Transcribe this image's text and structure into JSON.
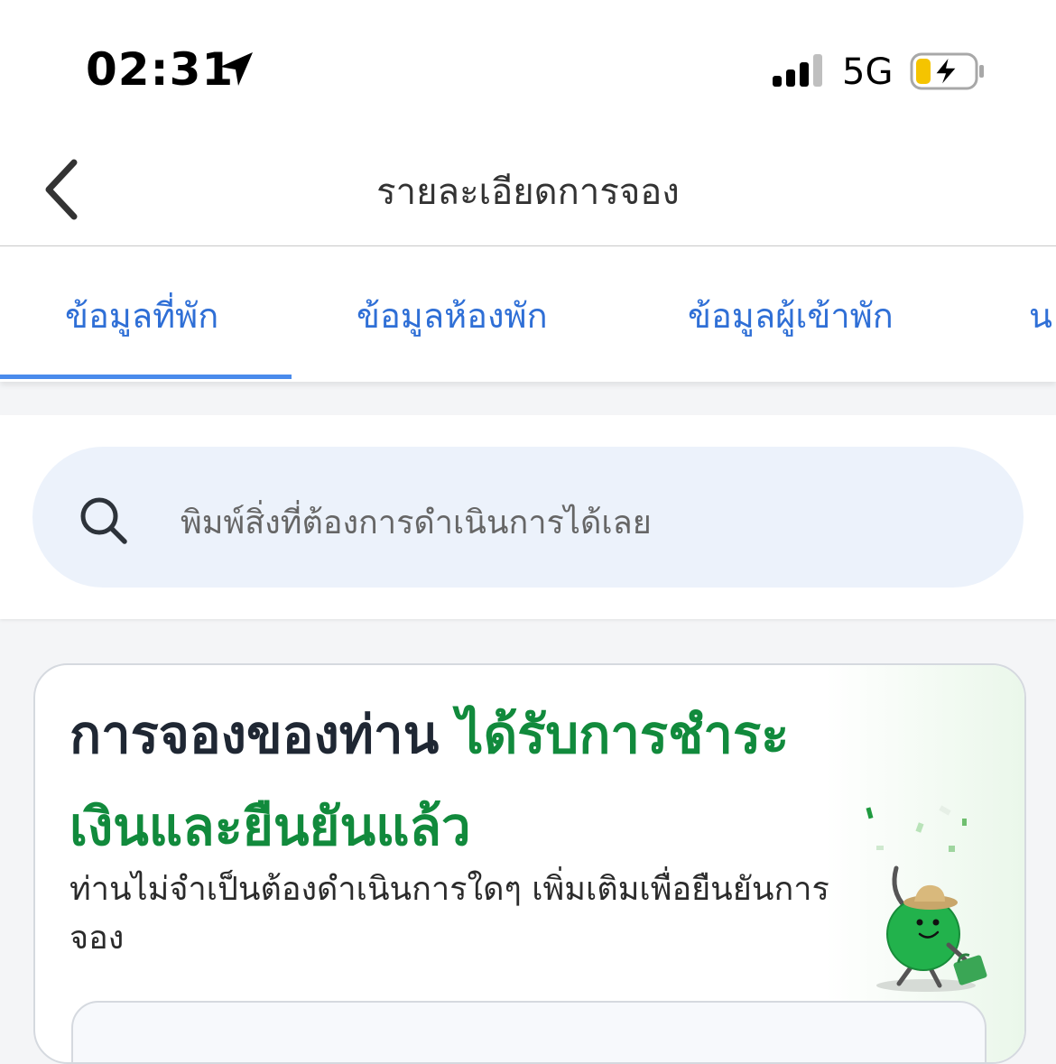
{
  "status_bar": {
    "time": "02:31",
    "network": "5G",
    "icons": [
      "location-arrow-icon",
      "signal-icon",
      "battery-charging-icon"
    ]
  },
  "header": {
    "title": "รายละเอียดการจอง",
    "back_icon": "chevron-left-icon"
  },
  "tabs": [
    {
      "label": "ข้อมูลที่พัก",
      "selected": true
    },
    {
      "label": "ข้อมูลห้องพัก",
      "selected": false
    },
    {
      "label": "ข้อมูลผู้เข้าพัก",
      "selected": false
    },
    {
      "label": "น",
      "selected": false
    }
  ],
  "search": {
    "placeholder": "พิมพ์สิ่งที่ต้องการดำเนินการได้เลย",
    "icon": "search-icon"
  },
  "status_card": {
    "heading_part1": "การจองของท่าน ",
    "heading_part2": "ได้รับการชำระเงินและยืนยันแล้ว",
    "description": "ท่านไม่จำเป็นต้องดำเนินการใดๆ เพิ่มเติมเพื่อยืนยันการจอง",
    "illustration": "green-mascot-traveler"
  },
  "colors": {
    "accent_blue": "#2f6fd6",
    "tab_indicator": "#4a8bec",
    "confirm_green": "#118a3c",
    "search_bg": "#ecf2fb"
  }
}
